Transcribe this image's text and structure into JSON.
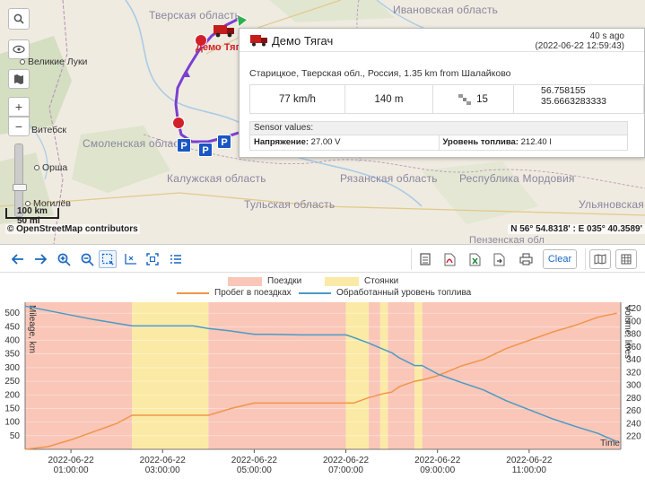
{
  "map": {
    "regions": [
      {
        "id": "tver",
        "label": "Тверская область"
      },
      {
        "id": "ivanovo",
        "label": "Ивановская область"
      },
      {
        "id": "smolensk",
        "label": "Смоленская област"
      },
      {
        "id": "kaluga",
        "label": "Калужская область"
      },
      {
        "id": "ryazan",
        "label": "Рязанская область"
      },
      {
        "id": "mordovia",
        "label": "Республика Мордовия"
      },
      {
        "id": "tula",
        "label": "Тульская область"
      },
      {
        "id": "ulyanovsk",
        "label": "Ульяновская"
      },
      {
        "id": "penza",
        "label": "Пензенская обл"
      }
    ],
    "cities": [
      {
        "id": "velikie-luki",
        "label": "Великие Луки"
      },
      {
        "id": "vitebsk",
        "label": "Витебск"
      },
      {
        "id": "orsha",
        "label": "Орша"
      },
      {
        "id": "mogilev",
        "label": "Могилёв"
      }
    ],
    "vehicle_label": "Демо Тяг",
    "scale_km": "100 km",
    "scale_mi": "50 mi",
    "attribution": "© OpenStreetMap contributors",
    "coordinates": "N 56° 54.8318' : E 035° 40.3589'",
    "parking_symbol": "P",
    "accent": "#1a56c4",
    "route_color": "#7b3fd0",
    "stop_color": "#d2202a"
  },
  "popup": {
    "title": "Демо Тягач",
    "ago": "40 s ago",
    "time": "(2022-06-22 12:59:43)",
    "address": "Старицкое, Тверская обл., Россия, 1.35 km from Шалайково",
    "speed": "77 km/h",
    "altitude": "140 m",
    "satellites": "15",
    "lat": "56.758155",
    "lon": "35.6663283333",
    "sensor_title": "Sensor values:",
    "voltage_label": "Напряжение:",
    "voltage_value": "27.00 V",
    "fuel_label": "Уровень топлива:",
    "fuel_value": "212.40 l"
  },
  "toolbar": {
    "clear_label": "Clear",
    "icons": [
      "arrow-left-icon",
      "arrow-right-icon",
      "zoom-in-icon",
      "zoom-out-icon",
      "select-area-icon",
      "time-axis-icon",
      "fit-icon",
      "list-icon",
      "table-icon",
      "pdf-icon",
      "excel-icon",
      "export-icon",
      "print-icon",
      "map-icon",
      "grid-icon"
    ]
  },
  "chart_data": {
    "type": "line",
    "legend_bands": [
      {
        "name": "Поездки",
        "color": "#f9c6b8"
      },
      {
        "name": "Стоянки",
        "color": "#fbeaa5"
      }
    ],
    "series": [
      {
        "name": "Пробег в поездках",
        "color": "#f0954a",
        "axis": "left",
        "x": [
          "00:00",
          "00:30",
          "01:00",
          "01:30",
          "02:00",
          "02:20",
          "03:00",
          "03:40",
          "04:00",
          "04:30",
          "05:00",
          "05:20",
          "06:00",
          "06:40",
          "07:00",
          "07:10",
          "07:30",
          "07:50",
          "08:00",
          "08:10",
          "08:30",
          "08:40",
          "09:00",
          "09:30",
          "10:00",
          "10:30",
          "11:00",
          "11:30",
          "12:00",
          "12:30",
          "12:55"
        ],
        "values": [
          0,
          10,
          35,
          65,
          95,
          125,
          125,
          125,
          125,
          150,
          170,
          170,
          170,
          170,
          170,
          170,
          190,
          205,
          210,
          230,
          250,
          255,
          270,
          305,
          330,
          370,
          400,
          430,
          455,
          485,
          500
        ]
      },
      {
        "name": "Обработанный уровень топлива",
        "color": "#4a9ac7",
        "axis": "right",
        "x": [
          "00:00",
          "00:30",
          "01:00",
          "01:30",
          "02:00",
          "02:20",
          "03:00",
          "03:40",
          "04:00",
          "04:30",
          "05:00",
          "05:20",
          "06:00",
          "06:40",
          "07:00",
          "07:10",
          "07:30",
          "07:50",
          "08:00",
          "08:10",
          "08:30",
          "08:40",
          "09:00",
          "09:30",
          "10:00",
          "10:30",
          "11:00",
          "11:30",
          "12:00",
          "12:30",
          "12:55"
        ],
        "values": [
          424,
          417,
          410,
          403,
          397,
          393,
          393,
          393,
          389,
          385,
          380,
          380,
          379,
          379,
          379,
          375,
          366,
          356,
          351,
          343,
          331,
          331,
          318,
          305,
          293,
          276,
          262,
          248,
          236,
          225,
          212
        ]
      }
    ],
    "bands": [
      {
        "type": "trip",
        "from": "00:00",
        "to": "02:20"
      },
      {
        "type": "stop",
        "from": "02:20",
        "to": "04:00"
      },
      {
        "type": "trip",
        "from": "04:00",
        "to": "07:00"
      },
      {
        "type": "stop",
        "from": "07:00",
        "to": "07:30"
      },
      {
        "type": "trip",
        "from": "07:30",
        "to": "07:45"
      },
      {
        "type": "stop",
        "from": "07:45",
        "to": "07:55"
      },
      {
        "type": "trip",
        "from": "07:55",
        "to": "08:30"
      },
      {
        "type": "stop",
        "from": "08:30",
        "to": "08:40"
      },
      {
        "type": "trip",
        "from": "08:40",
        "to": "13:00"
      }
    ],
    "x_ticks": [
      {
        "date": "2022-06-22",
        "time": "01:00:00"
      },
      {
        "date": "2022-06-22",
        "time": "03:00:00"
      },
      {
        "date": "2022-06-22",
        "time": "05:00:00"
      },
      {
        "date": "2022-06-22",
        "time": "07:00:00"
      },
      {
        "date": "2022-06-22",
        "time": "09:00:00"
      },
      {
        "date": "2022-06-22",
        "time": "11:00:00"
      }
    ],
    "xlim": [
      "00:00",
      "13:00"
    ],
    "y_left_ticks": [
      50,
      100,
      150,
      200,
      250,
      300,
      350,
      400,
      450,
      500
    ],
    "ylim_left": [
      0,
      540
    ],
    "y_right_ticks": [
      220,
      240,
      260,
      280,
      300,
      320,
      340,
      360,
      380,
      400,
      420
    ],
    "ylim_right": [
      200,
      430
    ],
    "ylabel_left": "Mileage, km",
    "ylabel_right": "Volume, litres",
    "xlabel": "Time"
  }
}
